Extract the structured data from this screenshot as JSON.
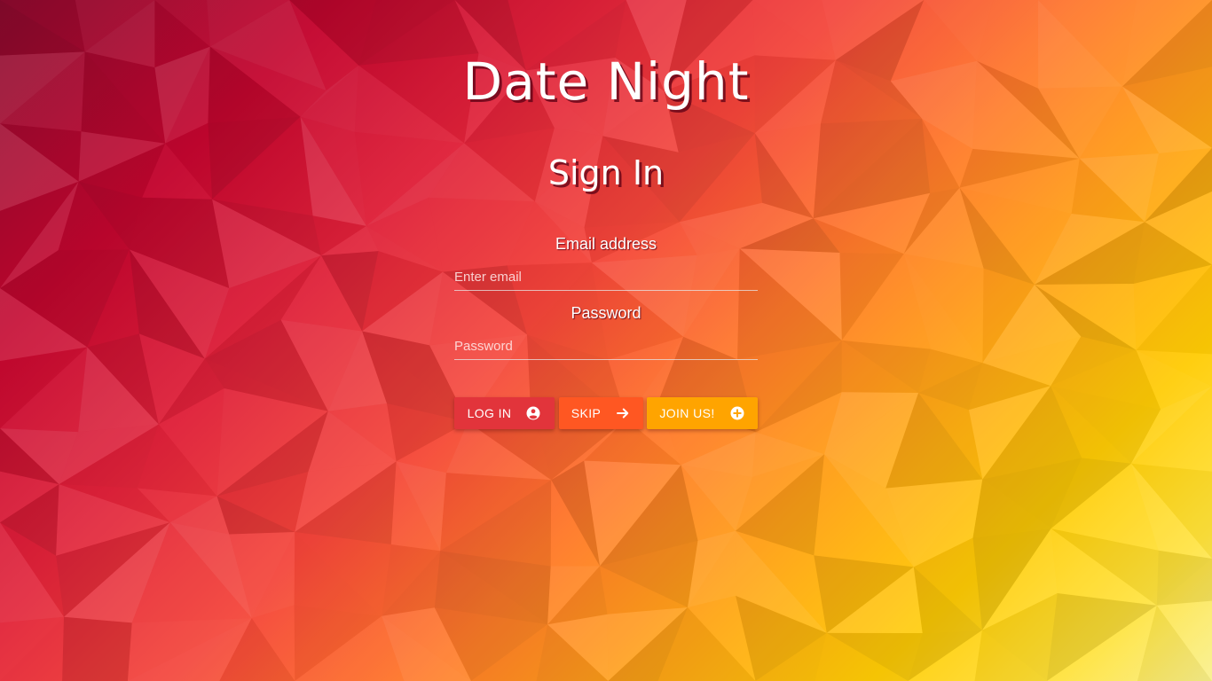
{
  "app": {
    "title": "Date Night"
  },
  "signin": {
    "heading": "Sign In",
    "email": {
      "label": "Email address",
      "placeholder": "Enter email",
      "value": ""
    },
    "password": {
      "label": "Password",
      "placeholder": "Password",
      "value": ""
    },
    "buttons": {
      "login": {
        "label": "LOG IN",
        "icon": "account-circle-icon",
        "color": "#e2343b"
      },
      "skip": {
        "label": "SKIP",
        "icon": "arrow-right-icon",
        "color": "#ff5722"
      },
      "join": {
        "label": "JOIN US!",
        "icon": "add-circle-icon",
        "color": "#ffa400"
      }
    }
  },
  "theme": {
    "background": "low-poly red-to-yellow gradient",
    "text_color": "#ffffff"
  }
}
